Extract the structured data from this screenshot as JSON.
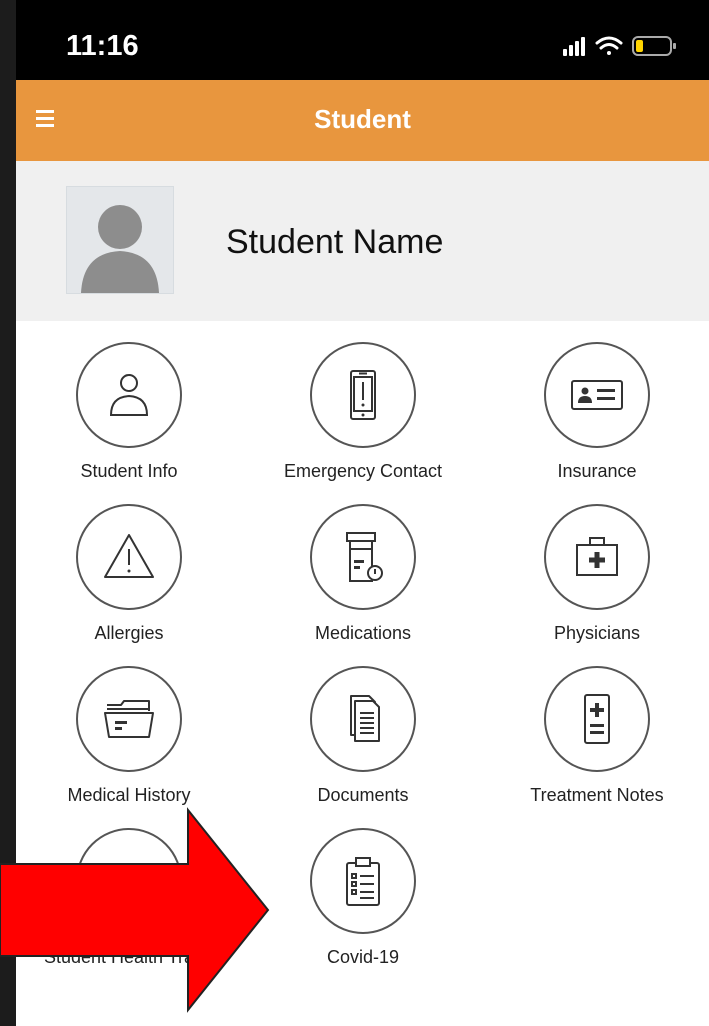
{
  "status_bar": {
    "time": "11:16",
    "icons": [
      "signal-icon",
      "wifi-icon",
      "battery-icon"
    ]
  },
  "header": {
    "title": "Student",
    "menu_icon": "hamburger-icon",
    "bg_color": "#E8963E"
  },
  "profile": {
    "name": "Student Name",
    "avatar_icon": "person-silhouette-icon"
  },
  "tiles": [
    {
      "label": "Student Info",
      "icon": "person-icon"
    },
    {
      "label": "Emergency Contact",
      "icon": "phone-alert-icon"
    },
    {
      "label": "Insurance",
      "icon": "id-card-icon"
    },
    {
      "label": "Allergies",
      "icon": "warning-icon"
    },
    {
      "label": "Medications",
      "icon": "pill-bottle-icon"
    },
    {
      "label": "Physicians",
      "icon": "medical-kit-icon"
    },
    {
      "label": "Medical History",
      "icon": "folder-icon"
    },
    {
      "label": "Documents",
      "icon": "documents-icon"
    },
    {
      "label": "Treatment Notes",
      "icon": "treatment-notes-icon"
    },
    {
      "label": "Student Health Tracker",
      "icon": "health-tracker-icon"
    },
    {
      "label": "Covid-19",
      "icon": "clipboard-list-icon"
    }
  ],
  "annotation": {
    "arrow_color": "#FF0000"
  }
}
